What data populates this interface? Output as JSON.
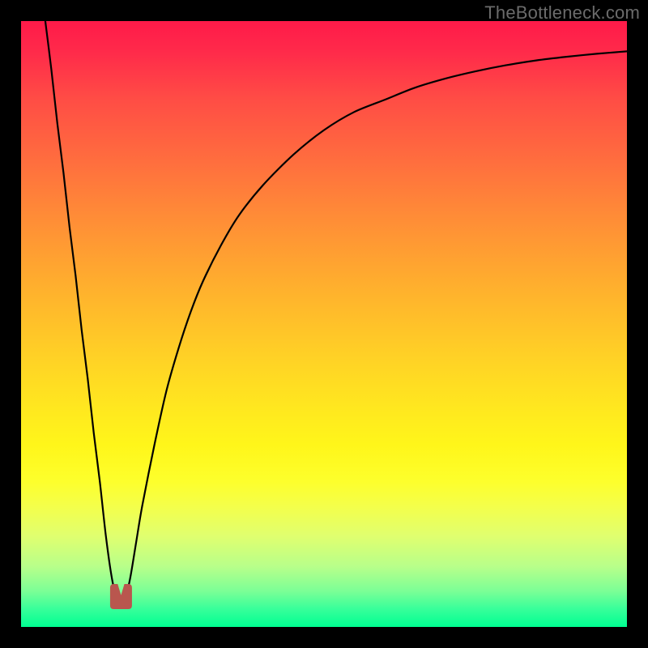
{
  "watermark": "TheBottleneck.com",
  "chart_data": {
    "type": "line",
    "title": "",
    "xlabel": "",
    "ylabel": "",
    "xlim": [
      0,
      100
    ],
    "ylim": [
      0,
      100
    ],
    "grid": false,
    "legend": false,
    "gradient_bands": [
      {
        "position": 0,
        "color": "#ff1a49"
      },
      {
        "position": 5,
        "color": "#ff2a4a"
      },
      {
        "position": 13,
        "color": "#ff4d45"
      },
      {
        "position": 22,
        "color": "#ff6a3f"
      },
      {
        "position": 32,
        "color": "#ff8b37"
      },
      {
        "position": 43,
        "color": "#ffad2e"
      },
      {
        "position": 55,
        "color": "#ffd026"
      },
      {
        "position": 64,
        "color": "#ffe81f"
      },
      {
        "position": 70,
        "color": "#fff61a"
      },
      {
        "position": 76,
        "color": "#fdff2c"
      },
      {
        "position": 80,
        "color": "#f4ff4a"
      },
      {
        "position": 85,
        "color": "#e0ff6f"
      },
      {
        "position": 90,
        "color": "#b8ff8a"
      },
      {
        "position": 94,
        "color": "#7dff96"
      },
      {
        "position": 97,
        "color": "#38ff9a"
      },
      {
        "position": 100,
        "color": "#00ff92"
      }
    ],
    "series": [
      {
        "name": "bottleneck-curve",
        "x": [
          4,
          5,
          6,
          7,
          8,
          9,
          10,
          11,
          12,
          13,
          14,
          15,
          16,
          17,
          18,
          19,
          20,
          22,
          24,
          26,
          28,
          30,
          33,
          36,
          40,
          45,
          50,
          55,
          60,
          65,
          70,
          75,
          80,
          85,
          90,
          95,
          100
        ],
        "y": [
          100,
          92,
          83,
          75,
          66,
          58,
          49,
          41,
          32,
          24,
          15,
          8,
          4,
          4,
          8,
          14,
          20,
          30,
          39,
          46,
          52,
          57,
          63,
          68,
          73,
          78,
          82,
          85,
          87,
          89,
          90.5,
          91.7,
          92.7,
          93.5,
          94.1,
          94.6,
          95
        ]
      }
    ],
    "minimum_x": 16.5,
    "minimum_marker": {
      "shape": "u",
      "x_center": 16.5,
      "y_base": 3,
      "color": "#b9564e"
    }
  }
}
